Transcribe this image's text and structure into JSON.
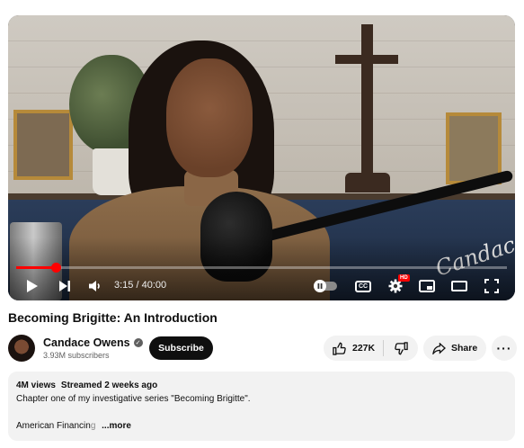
{
  "player": {
    "time_display": "3:15 / 40:00",
    "progress_fraction": 0.08,
    "overlay_signature": "Candace",
    "cc_label": "CC",
    "hd_badge": "HD",
    "colors": {
      "progress": "#ff0000"
    },
    "icons": [
      "play-icon",
      "next-icon",
      "volume-icon",
      "autoplay-toggle",
      "captions-icon",
      "settings-icon",
      "miniplayer-icon",
      "theater-icon",
      "fullscreen-icon"
    ]
  },
  "video": {
    "title": "Becoming Brigitte: An Introduction"
  },
  "channel": {
    "name": "Candace Owens",
    "subscribers": "3.93M subscribers",
    "subscribe_label": "Subscribe"
  },
  "actions": {
    "likes": "227K",
    "share_label": "Share",
    "more_label": "···"
  },
  "description": {
    "views": "4M views",
    "streamed": "Streamed 2 weeks ago",
    "line1": "Chapter one of my investigative series \"Becoming Brigitte\".",
    "line2_text": "American Financin",
    "line2_faded": "g",
    "more_label": "...more"
  }
}
